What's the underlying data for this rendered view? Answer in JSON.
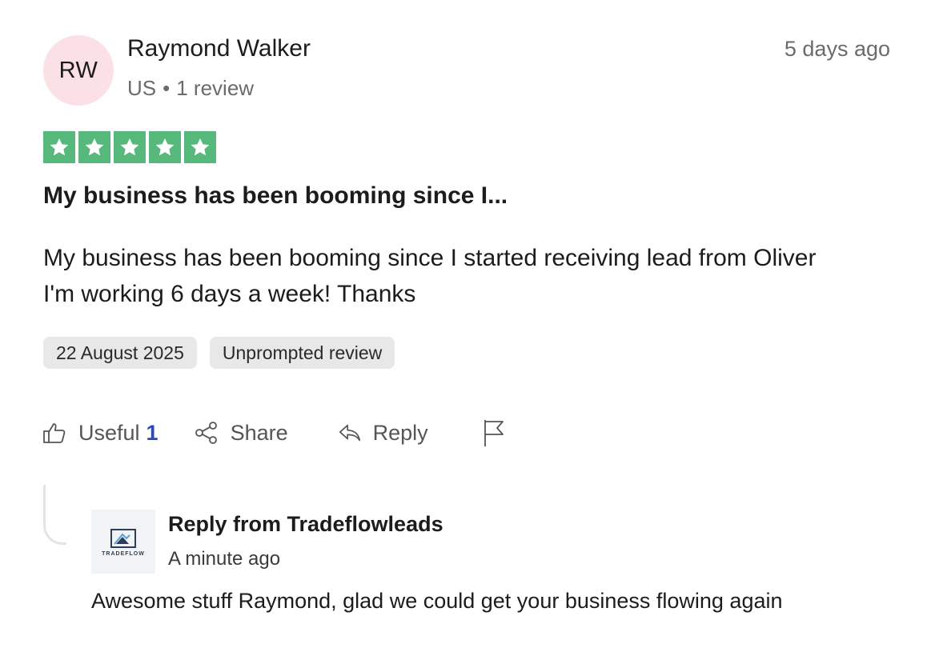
{
  "reviewer": {
    "initials": "RW",
    "name": "Raymond Walker",
    "country": "US",
    "separator": "•",
    "review_count": "1 review",
    "avatar_color": "#fbe0e6"
  },
  "review": {
    "age": "5 days ago",
    "rating": 5,
    "rating_max": 5,
    "star_color": "#56b87b",
    "title": "My business has been booming since I...",
    "body": "My business has been booming since I started receiving lead from Oliver I'm working 6 days a week! Thanks",
    "date": "22 August 2025",
    "label": "Unprompted review"
  },
  "actions": {
    "useful_label": "Useful",
    "useful_count": "1",
    "share_label": "Share",
    "reply_label": "Reply",
    "flag_icon": "flag-icon"
  },
  "company_reply": {
    "logo_text": "TRADEFLOW",
    "title": "Reply from Tradeflowleads",
    "time": "A minute ago",
    "text": "Awesome stuff Raymond, glad we could get your business flowing again"
  }
}
